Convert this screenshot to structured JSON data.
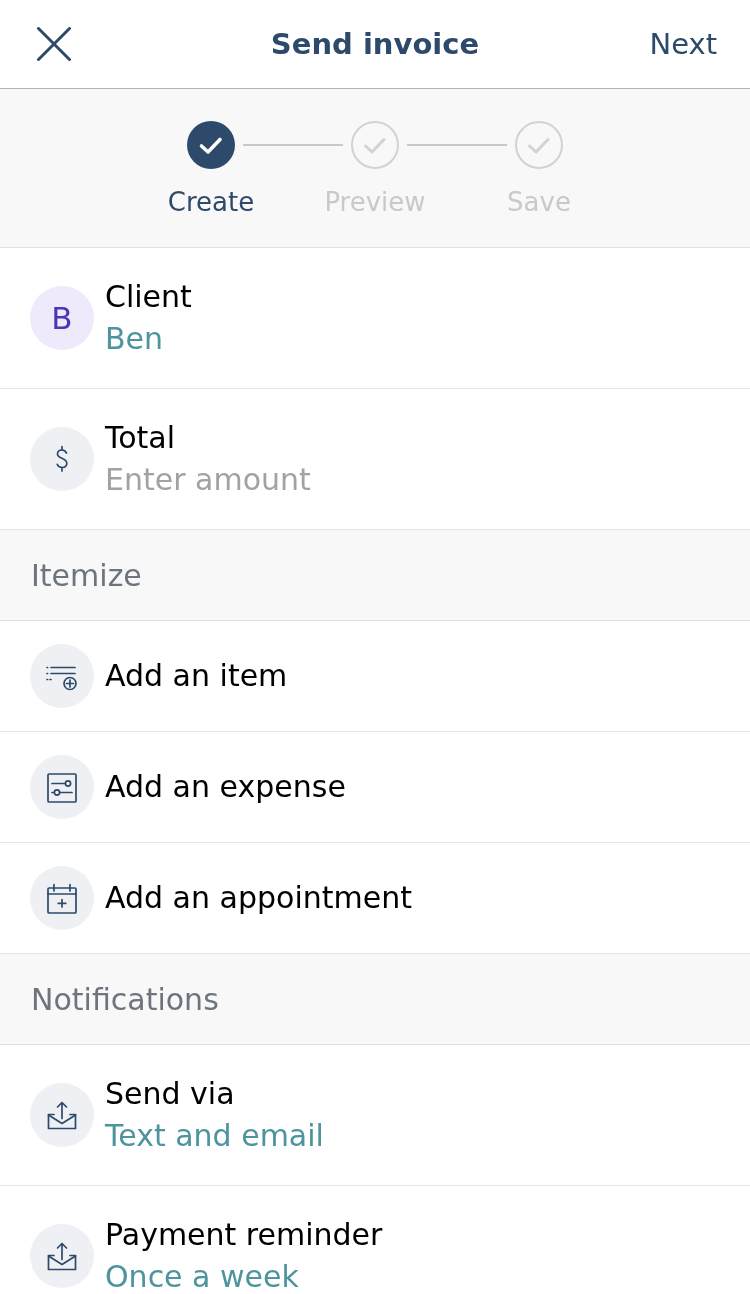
{
  "header": {
    "title": "Send invoice",
    "next": "Next"
  },
  "stepper": {
    "steps": [
      {
        "label": "Create",
        "current": true
      },
      {
        "label": "Preview",
        "current": false
      },
      {
        "label": "Save",
        "current": false
      }
    ]
  },
  "sections": [
    {
      "rows": [
        {
          "kind": "contact",
          "initial": "B",
          "label": "Client",
          "value": "Ben"
        },
        {
          "kind": "amount",
          "label": "Total",
          "placeholder": "Enter amount"
        }
      ]
    },
    {
      "title": "Itemize",
      "rows": [
        {
          "kind": "item",
          "label": "Add an item"
        },
        {
          "kind": "expense",
          "label": "Add an expense"
        },
        {
          "kind": "appointment",
          "label": "Add an appointment"
        }
      ]
    },
    {
      "title": "Notifications",
      "rows": [
        {
          "kind": "delivery",
          "label": "Send via",
          "value": "Text and email"
        },
        {
          "kind": "reminder",
          "label": "Payment reminder",
          "value": "Once a week"
        }
      ]
    }
  ]
}
